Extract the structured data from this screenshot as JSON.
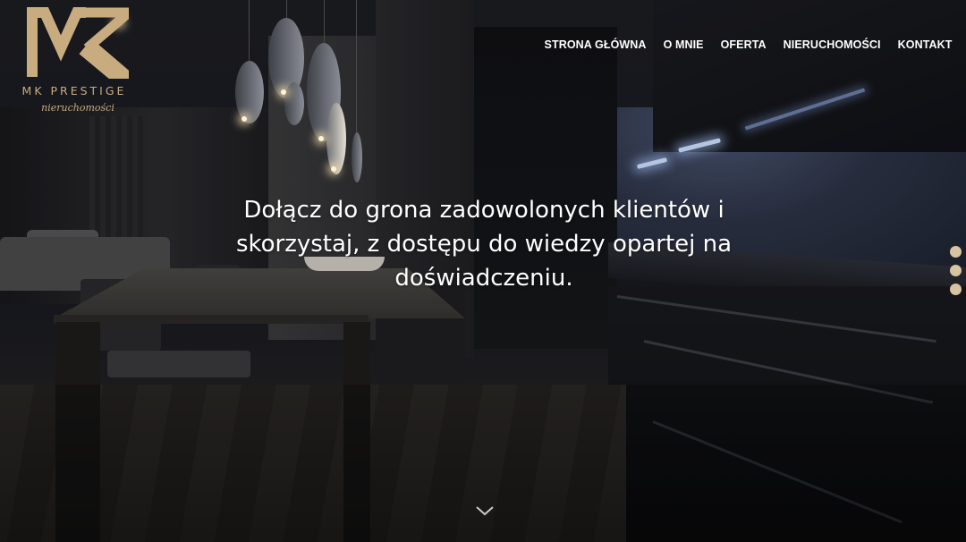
{
  "brand": {
    "name": "MK PRESTIGE",
    "tagline": "nieruchomości",
    "accent_color": "#c8ab7e"
  },
  "nav": {
    "items": [
      {
        "label": "STRONA GŁÓWNA"
      },
      {
        "label": "O MNIE"
      },
      {
        "label": "OFERTA"
      },
      {
        "label": "NIERUCHOMOŚCI"
      },
      {
        "label": "KONTAKT"
      }
    ]
  },
  "hero": {
    "headline": "Dołącz do grona zadowolonych klientów i skorzystaj, z dostępu do wiedzy opartej na doświadczeniu."
  },
  "slider": {
    "dot_count": 3,
    "dot_color": "#d8c4a1"
  },
  "icons": {
    "scroll": "chevron-down-icon"
  }
}
